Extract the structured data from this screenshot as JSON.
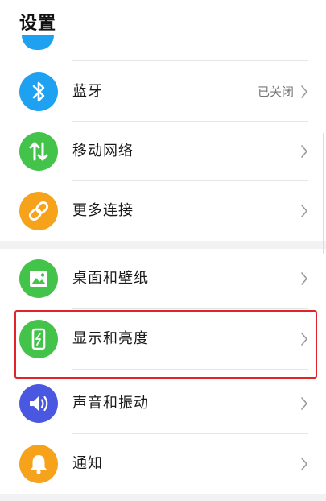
{
  "header": {
    "title": "设置"
  },
  "settings": {
    "bluetooth": {
      "label": "蓝牙",
      "value": "已关闭",
      "icon": "bluetooth-icon",
      "color": "#1ea1f1"
    },
    "mobile_network": {
      "label": "移动网络",
      "icon": "mobile-data-icon",
      "color": "#43c34a"
    },
    "more_connections": {
      "label": "更多连接",
      "icon": "link-icon",
      "color": "#f7a21b"
    },
    "wallpaper": {
      "label": "桌面和壁纸",
      "icon": "image-icon",
      "color": "#43c34a"
    },
    "display": {
      "label": "显示和亮度",
      "icon": "phone-brightness-icon",
      "color": "#43c34a"
    },
    "sound": {
      "label": "声音和振动",
      "icon": "speaker-icon",
      "color": "#4a57e0"
    },
    "notifications": {
      "label": "通知",
      "icon": "bell-icon",
      "color": "#f7a21b"
    }
  },
  "highlight_color": "#e0242a"
}
